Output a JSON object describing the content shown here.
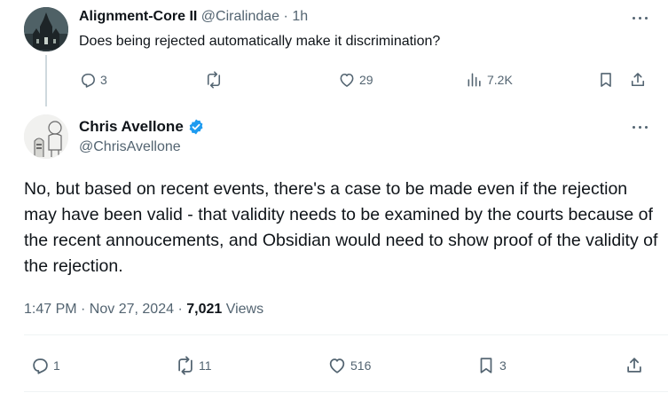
{
  "parent": {
    "name": "Alignment-Core II",
    "handle": "@Ciralindae",
    "separator": "·",
    "time": "1h",
    "text": "Does being rejected automatically make it discrimination?",
    "actions": {
      "replies": "3",
      "reposts": "",
      "likes": "29",
      "views": "7.2K"
    }
  },
  "tweet": {
    "name": "Chris Avellone",
    "verified_color": "#1d9bf0",
    "handle": "@ChrisAvellone",
    "text": "No, but based on recent events, there's a case to be made even if the rejection may have been valid - that validity needs to be examined by the courts because of the recent annoucements, and Obsidian would need to show proof of the validity of the rejection.",
    "timestamp": "1:47 PM · Nov 27, 2024",
    "meta_separator": "·",
    "views_count": "7,021",
    "views_label": "Views",
    "actions": {
      "replies": "1",
      "reposts": "11",
      "likes": "516",
      "bookmarks": "3"
    }
  },
  "icons": [
    "more-icon",
    "reply-icon",
    "repost-icon",
    "like-icon",
    "views-icon",
    "bookmark-icon",
    "share-icon",
    "verified-badge-icon"
  ],
  "colors": {
    "text": "#0f1419",
    "muted": "#536471",
    "divider": "#eff3f4",
    "accent": "#1d9bf0"
  }
}
